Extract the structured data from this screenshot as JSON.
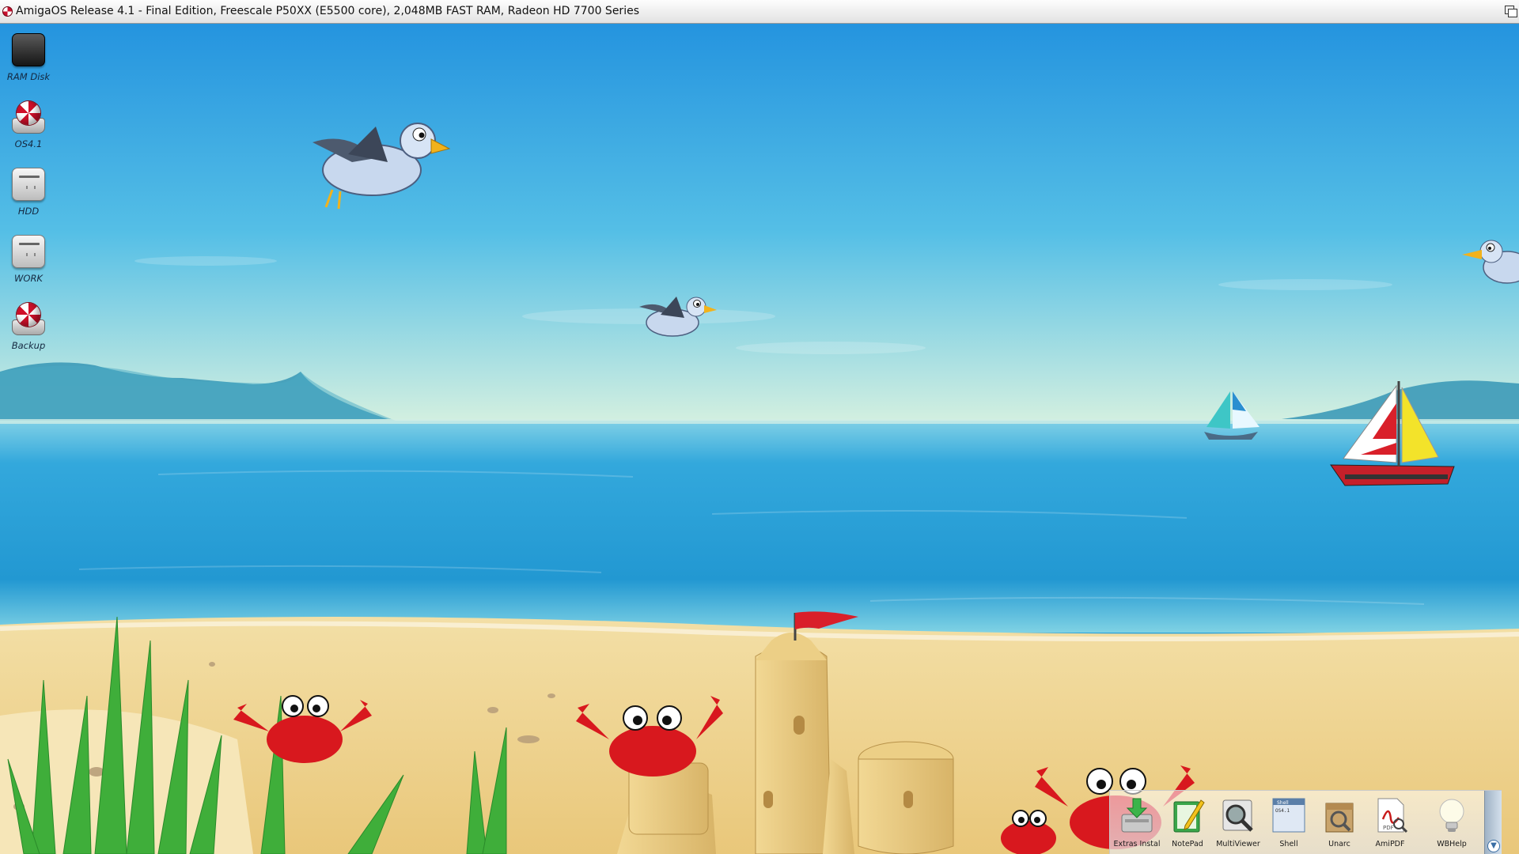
{
  "window": {
    "title": "AmigaOS Release 4.1 - Final Edition, Freescale P50XX (E5500 core), 2,048MB FAST RAM, Radeon HD 7700 Series"
  },
  "desktop_icons": [
    {
      "label": "RAM Disk",
      "icon": "ram-disk-icon"
    },
    {
      "label": "OS4.1",
      "icon": "boing-ball-disk-icon"
    },
    {
      "label": "HDD",
      "icon": "hard-drive-icon"
    },
    {
      "label": "WORK",
      "icon": "hard-drive-icon"
    },
    {
      "label": "Backup",
      "icon": "boing-ball-disk-icon"
    }
  ],
  "dock": {
    "items": [
      {
        "label": "Extras Instal",
        "icon": "install-icon"
      },
      {
        "label": "NotePad",
        "icon": "notepad-icon"
      },
      {
        "label": "MultiViewer",
        "icon": "multiviewer-icon"
      },
      {
        "label": "Shell",
        "icon": "shell-icon"
      },
      {
        "label": "Unarc",
        "icon": "unarc-icon"
      },
      {
        "label": "AmiPDF",
        "icon": "pdf-icon"
      },
      {
        "label": "WBHelp",
        "icon": "lightbulb-icon"
      }
    ],
    "shell_icon_text": [
      "Shell",
      "OS4.1"
    ],
    "pdf_icon_text": "PDF"
  },
  "colors": {
    "sky_top": "#1f8fde",
    "sky_horizon": "#d4f0e0",
    "sea": "#2aa3d9",
    "sand": "#efd390",
    "accent_red": "#d0102a"
  }
}
